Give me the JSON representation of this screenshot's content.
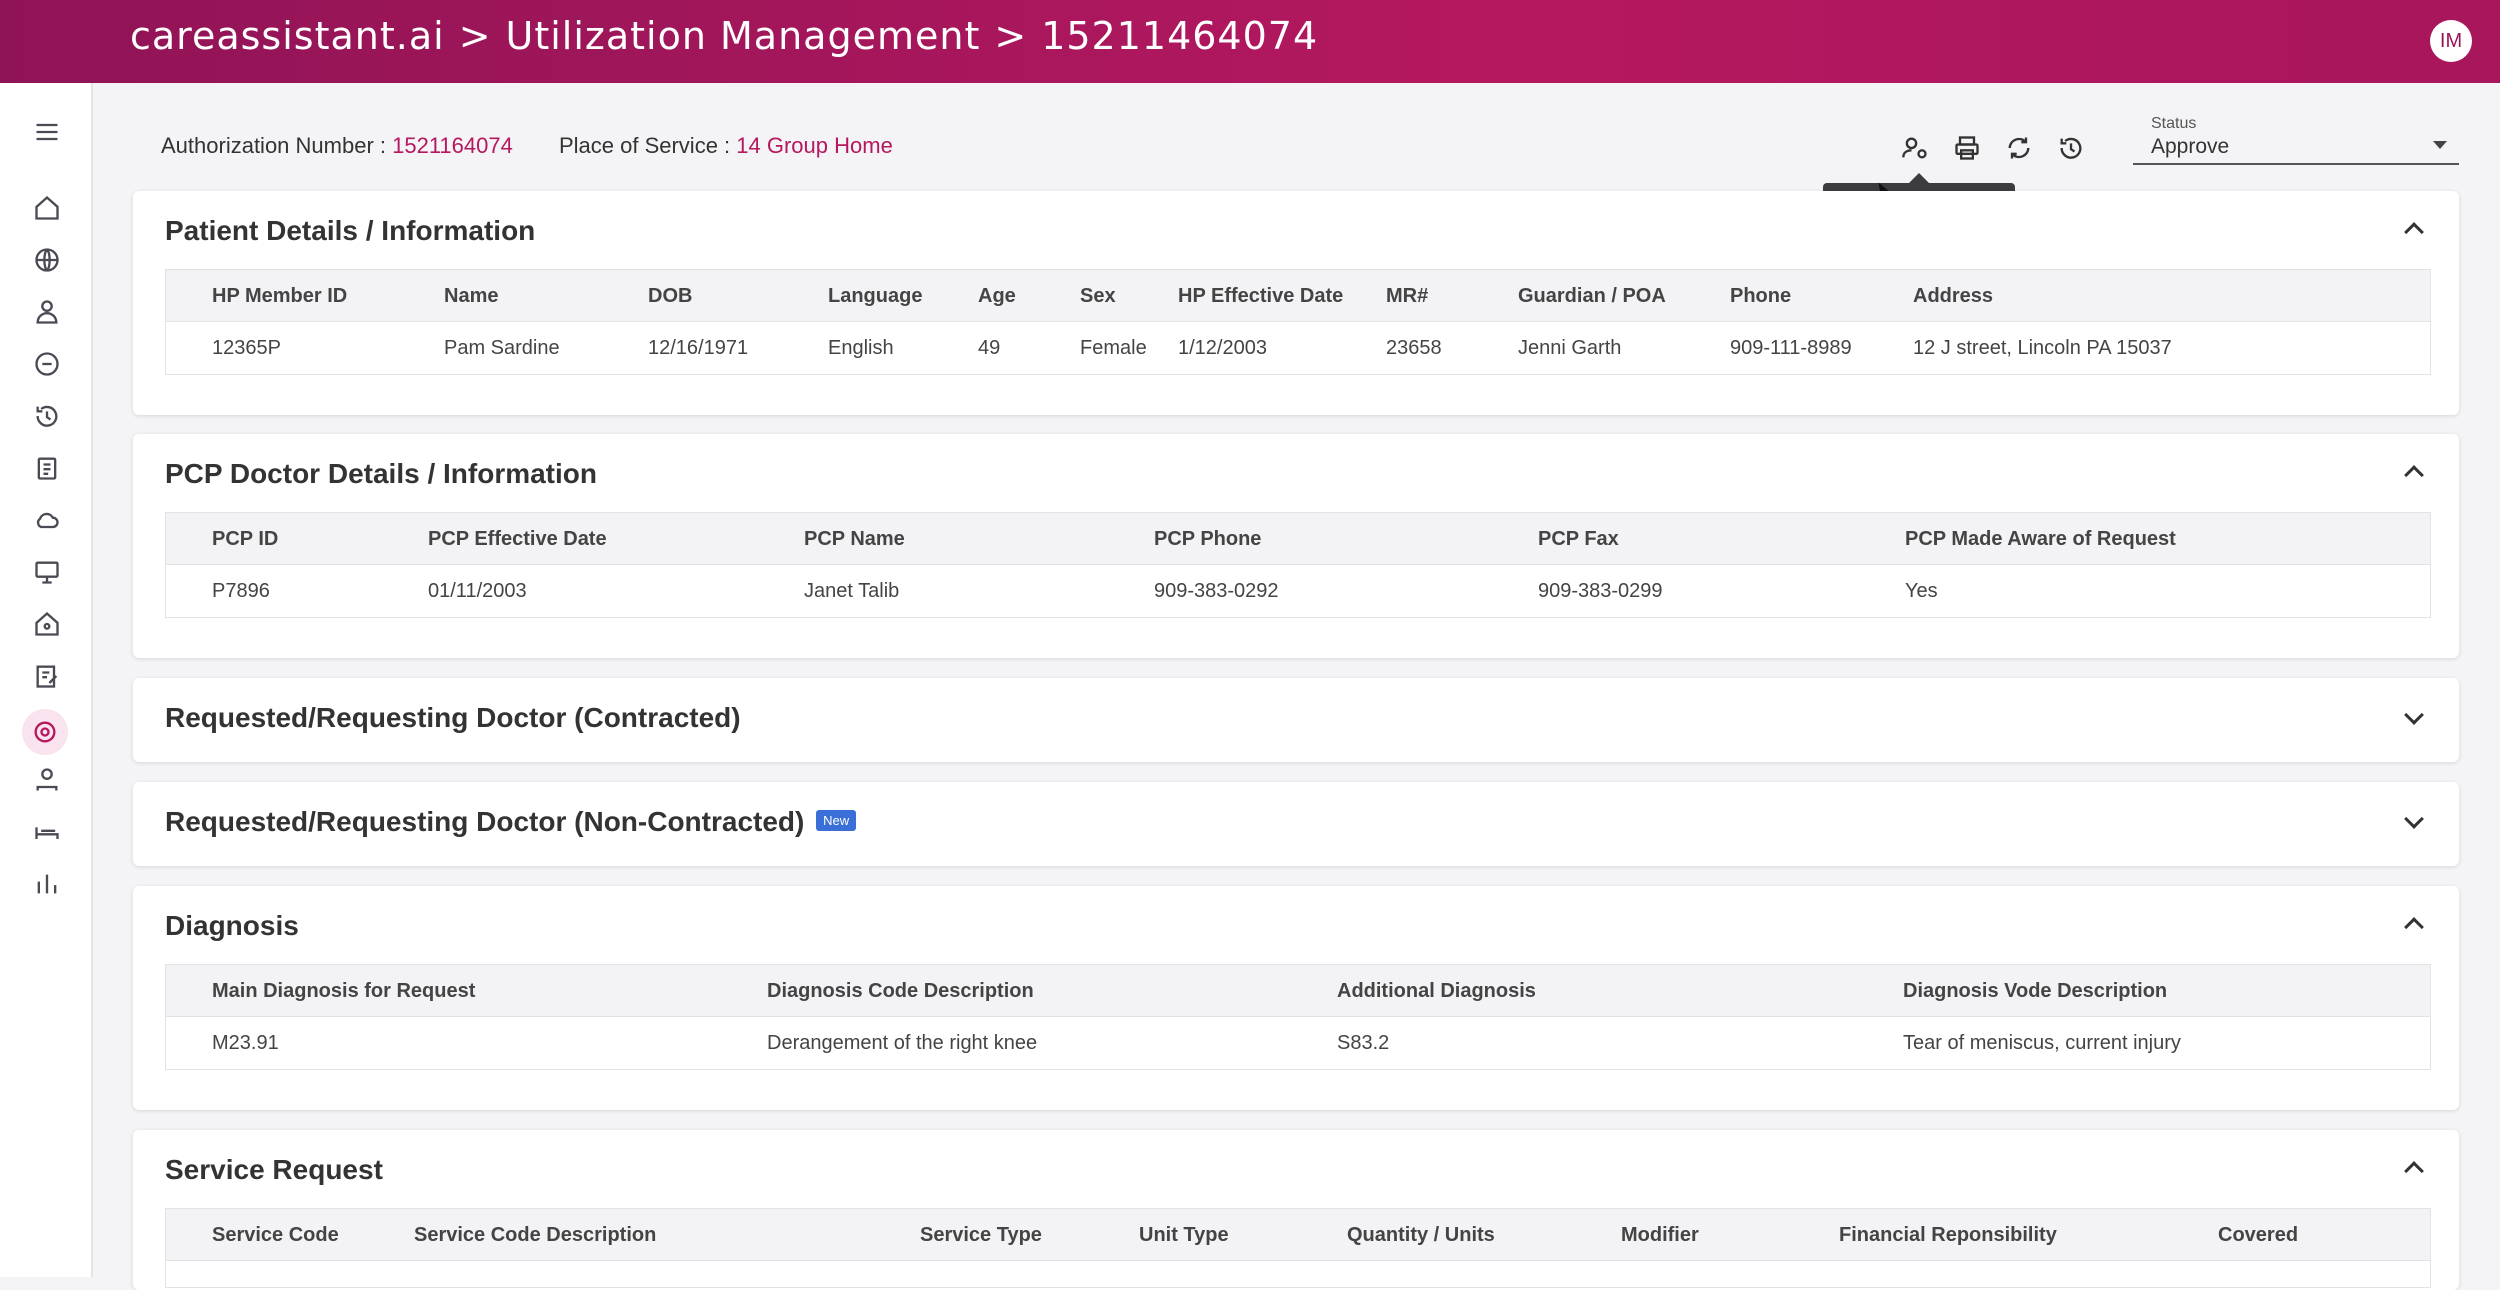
{
  "header": {
    "brand": "careassistant.ai",
    "crumb_sep": ">",
    "crumb1": "Utilization Management",
    "crumb2": "15211464074",
    "avatar": "IM"
  },
  "sidebar": {
    "items": [
      "home-icon",
      "globe-icon",
      "users-icon",
      "360-icon",
      "history-icon",
      "clipboard-icon",
      "cloud-sync-icon",
      "monitor-icon",
      "house-heart-icon",
      "edit-note-icon",
      "target-icon",
      "user-settings-icon",
      "bed-icon",
      "bar-chart-icon"
    ],
    "active": "target-icon"
  },
  "authbar": {
    "auth_label": "Authorization Number : ",
    "auth_value": "1521164074",
    "pos_label": "Place of Service : ",
    "pos_value": "14 Group Home"
  },
  "toolbar": {
    "icons": [
      "reassign-icon",
      "print-icon",
      "sync-icon",
      "history-icon"
    ],
    "tooltip": "Reassign"
  },
  "status": {
    "label": "Status",
    "value": "Approve"
  },
  "patient": {
    "title": "Patient Details / Information",
    "headers": [
      "HP Member ID",
      "Name",
      "DOB",
      "Language",
      "Age",
      "Sex",
      "HP Effective Date",
      "MR#",
      "Guardian / POA",
      "Phone",
      "Address"
    ],
    "row": [
      "12365P",
      "Pam Sardine",
      "12/16/1971",
      "English",
      "49",
      "Female",
      "1/12/2003",
      "23658",
      "Jenni Garth",
      "909-111-8989",
      "12 J street, Lincoln PA 15037"
    ]
  },
  "pcp": {
    "title": "PCP Doctor Details / Information",
    "headers": [
      "PCP ID",
      "PCP Effective Date",
      "PCP Name",
      "PCP Phone",
      "PCP Fax",
      "PCP Made Aware of Request"
    ],
    "row": [
      "P7896",
      "01/11/2003",
      "Janet Talib",
      "909-383-0292",
      "909-383-0299",
      "Yes"
    ]
  },
  "req_contracted": {
    "title": "Requested/Requesting Doctor (Contracted)"
  },
  "req_noncontracted": {
    "title": "Requested/Requesting Doctor (Non-Contracted)",
    "badge": "New"
  },
  "diagnosis": {
    "title": "Diagnosis",
    "headers": [
      "Main Diagnosis for Request",
      "Diagnosis Code Description",
      "Additional Diagnosis",
      "Diagnosis Vode Description"
    ],
    "row": [
      "M23.91",
      "Derangement of the right knee",
      "S83.2",
      "Tear of meniscus, current injury"
    ]
  },
  "service": {
    "title": "Service Request",
    "headers": [
      "Service Code",
      "Service Code Description",
      "Service Type",
      "Unit Type",
      "Quantity / Units",
      "Modifier",
      "Financial Reponsibility",
      "Covered"
    ]
  }
}
